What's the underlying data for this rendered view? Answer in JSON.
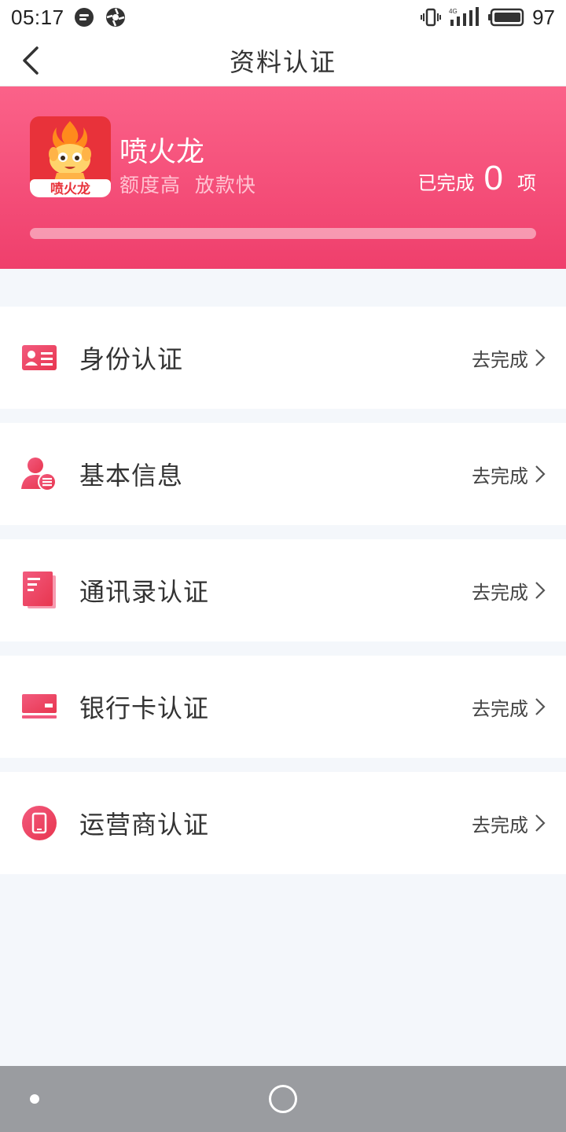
{
  "status_bar": {
    "time": "05:17",
    "battery": "97",
    "network": "4G"
  },
  "nav": {
    "title": "资料认证"
  },
  "banner": {
    "app_name": "喷火龙",
    "slogan": "额度高  放款快",
    "logo_text": "喷火龙",
    "completion_prefix": "已完成",
    "completion_count": "0",
    "completion_suffix": "项",
    "progress_fraction": 0,
    "accent_color": "#ef3f6c"
  },
  "cert_items": [
    {
      "label": "身份认证",
      "action": "去完成",
      "icon": "id-card-icon"
    },
    {
      "label": "基本信息",
      "action": "去完成",
      "icon": "user-info-icon"
    },
    {
      "label": "通讯录认证",
      "action": "去完成",
      "icon": "contacts-book-icon"
    },
    {
      "label": "银行卡认证",
      "action": "去完成",
      "icon": "bank-card-icon"
    },
    {
      "label": "运营商认证",
      "action": "去完成",
      "icon": "phone-carrier-icon"
    }
  ]
}
